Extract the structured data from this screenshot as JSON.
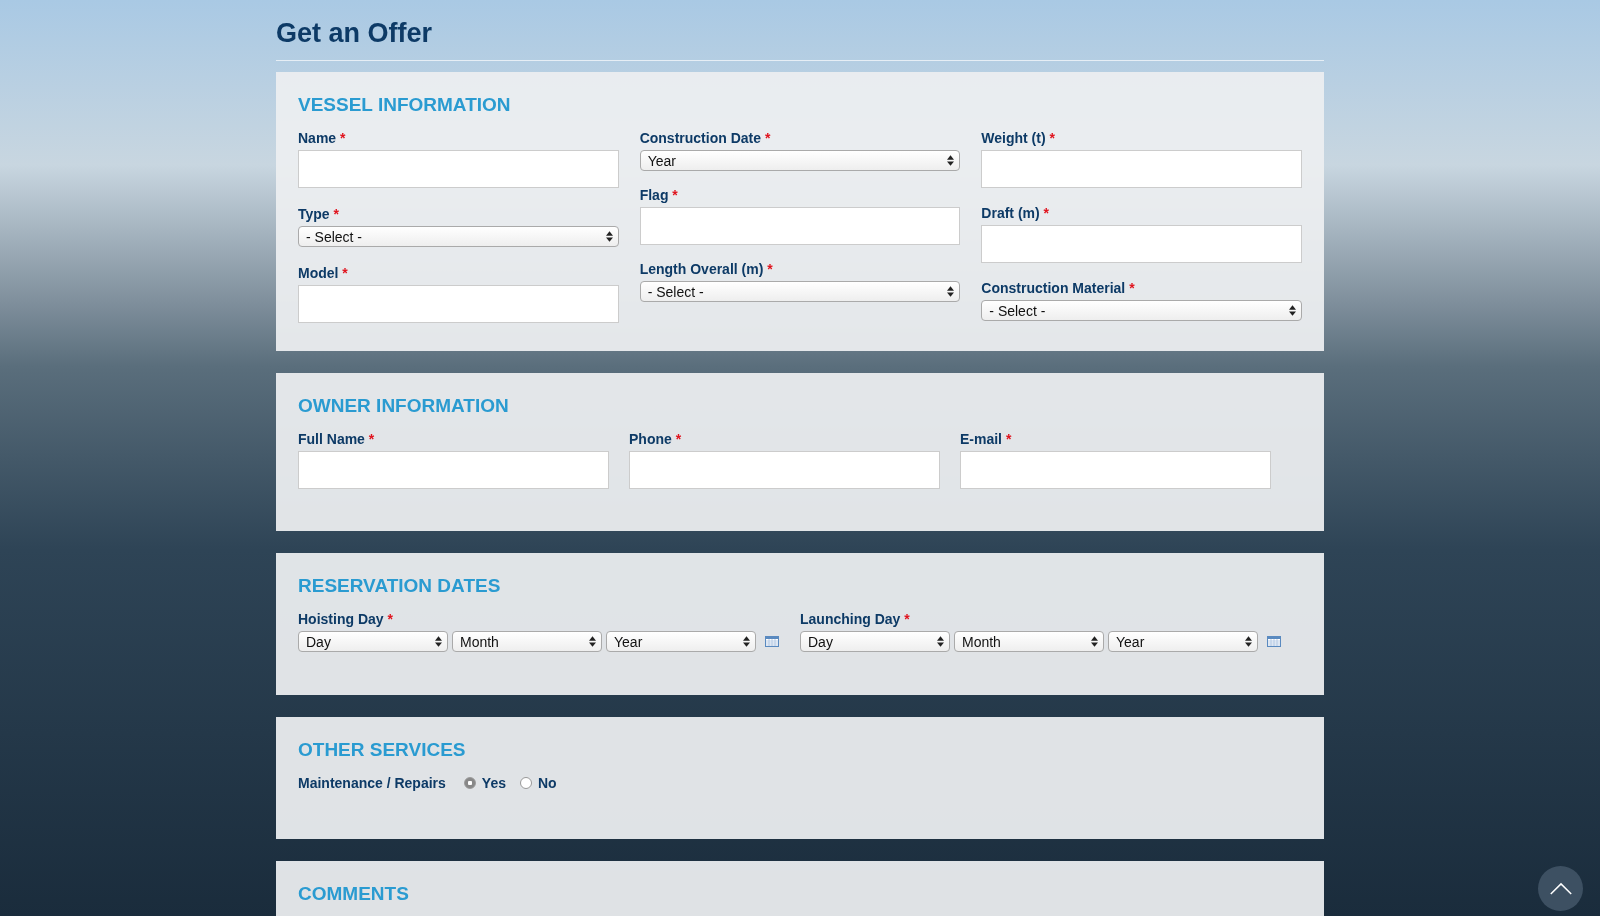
{
  "title": "Get an Offer",
  "vessel": {
    "heading": "VESSEL INFORMATION",
    "columns": [
      [
        {
          "label": "Name",
          "mark": "*",
          "kind": "text"
        },
        {
          "label": "Type",
          "mark": "*",
          "kind": "select",
          "value": "- Select -"
        },
        {
          "label": "Model",
          "mark": "*",
          "kind": "text"
        }
      ],
      [
        {
          "label": "Construction Date",
          "mark": "*",
          "kind": "select",
          "value": "Year"
        },
        {
          "label": "Flag",
          "mark": "*",
          "kind": "text"
        },
        {
          "label": "Length Overall (m)",
          "mark": "*",
          "kind": "select",
          "value": "- Select -"
        }
      ],
      [
        {
          "label": "Weight (t)",
          "mark": "*",
          "kind": "text"
        },
        {
          "label": "Draft (m)",
          "mark": "*",
          "kind": "text"
        },
        {
          "label": "Construction Material",
          "mark": "*",
          "kind": "select",
          "value": "- Select -"
        }
      ]
    ]
  },
  "owner": {
    "heading": "OWNER INFORMATION",
    "fields": [
      {
        "label": "Full Name",
        "mark": "*",
        "kind": "text"
      },
      {
        "label": "Phone",
        "mark": "*",
        "kind": "text"
      },
      {
        "label": "E-mail",
        "mark": "*",
        "kind": "text"
      }
    ]
  },
  "reservation": {
    "heading": "RESERVATION DATES",
    "dates": [
      {
        "label": "Hoisting Day",
        "mark": "*",
        "selects": [
          "Day",
          "Month",
          "Year"
        ]
      },
      {
        "label": "Launching Day",
        "mark": "*",
        "selects": [
          "Day",
          "Month",
          "Year"
        ]
      }
    ]
  },
  "services": {
    "heading": "OTHER SERVICES",
    "question": "Maintenance / Repairs",
    "options": [
      {
        "label": "Yes",
        "selected": true
      },
      {
        "label": "No",
        "selected": false
      }
    ]
  },
  "comments": {
    "heading": "COMMENTS"
  }
}
